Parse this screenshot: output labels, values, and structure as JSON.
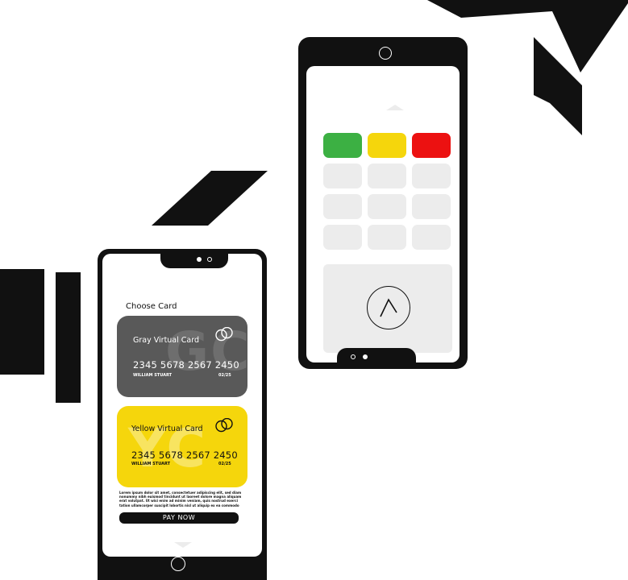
{
  "decorations": {
    "shapes": [
      "triangle-shard",
      "chevron-shard",
      "parallelogram-stripe",
      "vertical-bar",
      "vertical-bar"
    ],
    "color": "#111111"
  },
  "terminal": {
    "keypad": {
      "function_keys": [
        "confirm-key",
        "correction-key",
        "cancel-key"
      ],
      "key_colors": {
        "confirm": "#3cb043",
        "correction": "#f5d60c",
        "cancel": "#ec1111",
        "neutral": "#ececec"
      },
      "number_keys": 9
    },
    "pad_icon": "contactless-arrow-icon"
  },
  "wallet": {
    "title": "Choose Card",
    "cards": [
      {
        "name": "Gray Virtual Card",
        "watermark": "GC",
        "number": "2345 5678 2567 2450",
        "holder": "WILLIAM STUART",
        "expiry": "02/25",
        "color": "#595959"
      },
      {
        "name": "Yellow Virtual Card",
        "watermark": "YC",
        "number": "2345 5678 2567 2450",
        "holder": "WILLIAM STUART",
        "expiry": "02/25",
        "color": "#f5d60c"
      }
    ],
    "legal_text": "Lorem ipsum dolor sit amet, consectetuer adipiscing elit, sed diam nonummy nibh euismod tincidunt ut laoreet dolore magna aliquam erat volutpat. Ut wisi enim ad minim veniam, quis nostrud exerci tation ullamcorper suscipit lobortis nisl ut aliquip ex ea commodo consequat. Duis autem vel eum iriure dolor in hendrerit",
    "pay_button": "PAY NOW"
  }
}
